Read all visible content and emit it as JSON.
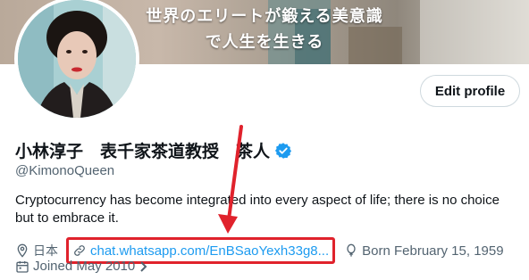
{
  "banner": {
    "line1": "世界のエリートが鍛える美意識",
    "line2": "で人生を生きる"
  },
  "profile": {
    "display_name": "小林淳子　表千家茶道教授　茶人",
    "handle": "@KimonoQueen",
    "bio": "Cryptocurrency has become integrated into every aspect of life; there is no choice but to embrace it.",
    "location": "日本",
    "link": "chat.whatsapp.com/EnBSaoYexh33g8...",
    "born": "Born February 15, 1959",
    "joined": "Joined May 2010"
  },
  "actions": {
    "edit_profile_label": "Edit profile"
  },
  "icons": {
    "verified": "verified-badge-icon",
    "location": "location-pin-icon",
    "link": "link-icon",
    "birthday": "balloon-icon",
    "calendar": "calendar-icon",
    "chevron": "chevron-right-icon"
  },
  "colors": {
    "accent_blue": "#1d9bf0",
    "annotation_red": "#e0222c",
    "secondary_text": "#536471"
  }
}
